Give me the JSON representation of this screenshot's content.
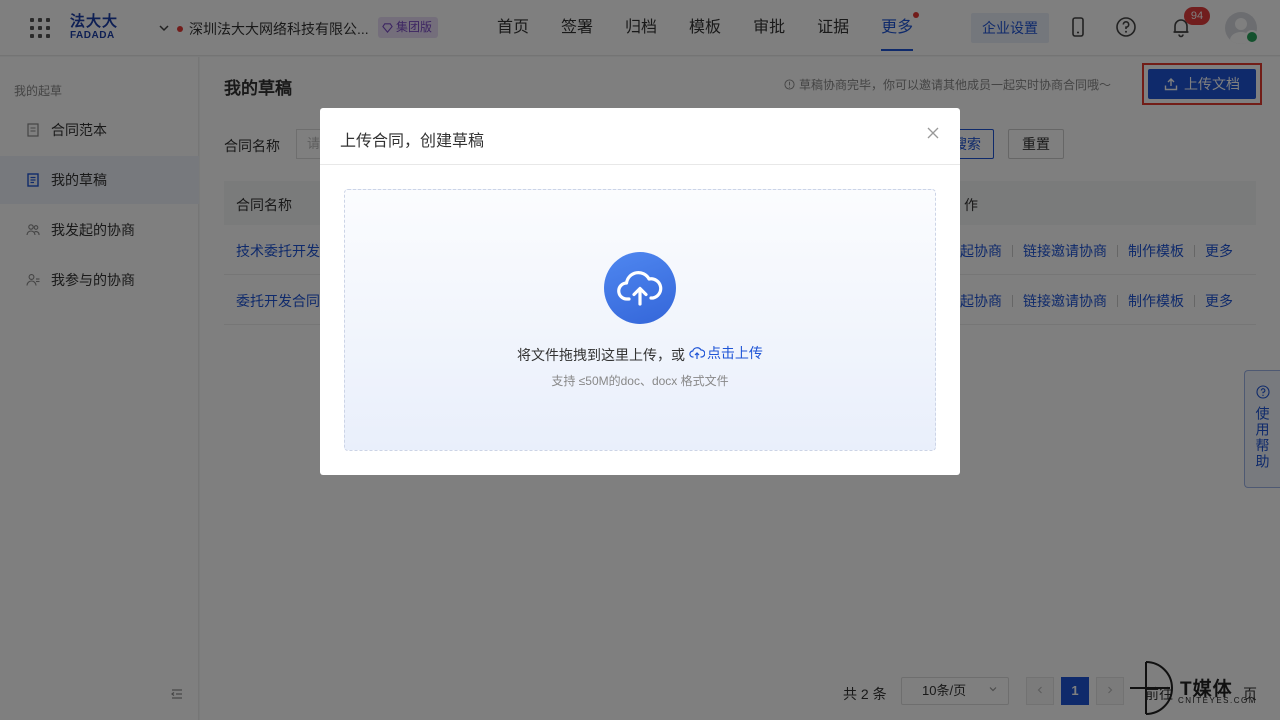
{
  "header": {
    "logo_line1": "法大大",
    "logo_line2": "FADADA",
    "company_name": "深圳法大大网络科技有限公...",
    "group_badge": "集团版",
    "nav": [
      "首页",
      "签署",
      "归档",
      "模板",
      "审批",
      "证据",
      "更多"
    ],
    "active_nav": "更多",
    "enterprise_settings": "企业设置",
    "notification_count": "94"
  },
  "sidebar": {
    "section_title": "我的起草",
    "items": [
      {
        "label": "合同范本",
        "icon": "document-icon"
      },
      {
        "label": "我的草稿",
        "icon": "draft-icon",
        "active": true
      },
      {
        "label": "我发起的协商",
        "icon": "users-icon"
      },
      {
        "label": "我参与的协商",
        "icon": "user-add-icon"
      }
    ]
  },
  "main": {
    "page_title": "我的草稿",
    "hint": "草稿协商完毕，你可以邀请其他成员一起实时协商合同哦～",
    "upload_button": "上传文档",
    "filter_label": "合同名称",
    "filter_placeholder": "请",
    "search_button": "搜索",
    "search_button_visible": "搜索",
    "reset_button": "重置",
    "columns": {
      "name": "合同名称",
      "actions": "操作",
      "actions_visible": "作"
    },
    "rows": [
      {
        "name": "技术委托开发",
        "actions": [
          "起协商",
          "链接邀请协商",
          "制作模板",
          "更多"
        ]
      },
      {
        "name": "委托开发合同",
        "actions": [
          "起协商",
          "链接邀请协商",
          "制作模板",
          "更多"
        ]
      }
    ],
    "pagination": {
      "total": "共 2 条",
      "page_size": "10条/页",
      "current_page": "1",
      "goto_prefix": "前往",
      "goto_suffix": "页"
    },
    "help_tab": "使用帮助"
  },
  "modal": {
    "title": "上传合同，创建草稿",
    "drop_text": "将文件拖拽到这里上传，或",
    "drop_link": "点击上传",
    "drop_sub": "支持 ≤50M的doc、docx 格式文件"
  },
  "watermark": {
    "brand": "T媒体",
    "sub": "CNITEYES.COM"
  },
  "colors": {
    "primary": "#1f55d6",
    "highlight_border": "#e43a2f",
    "badge_red": "#e23c3c"
  }
}
